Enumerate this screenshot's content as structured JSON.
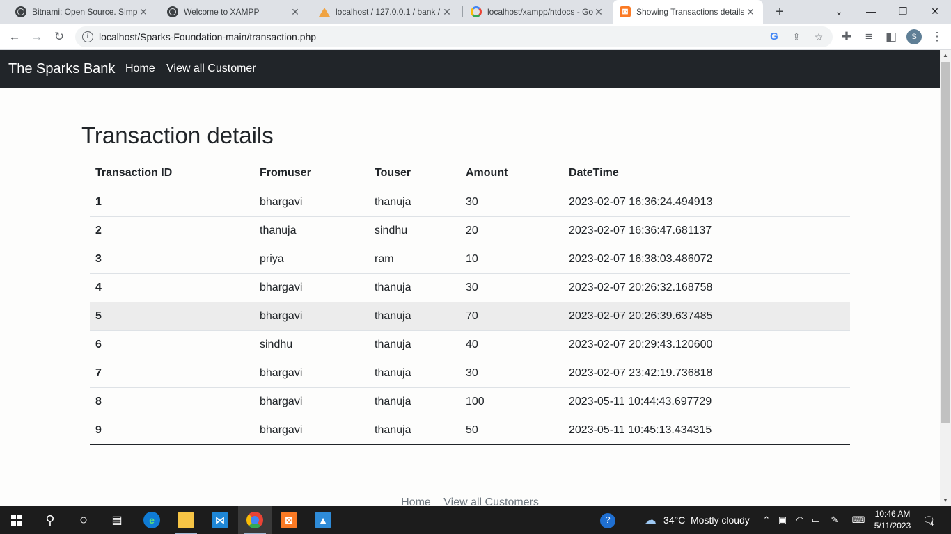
{
  "browser": {
    "tabs": [
      {
        "title": "Bitnami: Open Source. Simplified",
        "icon": "globe-icon",
        "active": false
      },
      {
        "title": "Welcome to XAMPP",
        "icon": "globe-icon",
        "active": false
      },
      {
        "title": "localhost / 127.0.0.1 / bank / ",
        "icon": "phpmyadmin-icon",
        "active": false
      },
      {
        "title": "localhost/xampp/htdocs - Google Search",
        "icon": "google-icon",
        "active": false
      },
      {
        "title": "Showing Transactions details",
        "icon": "xampp-icon",
        "active": true
      }
    ],
    "url": "localhost/Sparks-Foundation-main/transaction.php",
    "profile_initial": "S"
  },
  "navbar": {
    "brand": "The Sparks Bank",
    "links": [
      "Home",
      "View all Customer"
    ]
  },
  "page": {
    "title": "Transaction details",
    "table": {
      "headers": [
        "Transaction ID",
        "Fromuser",
        "Touser",
        "Amount",
        "DateTime"
      ],
      "rows": [
        [
          "1",
          "bhargavi",
          "thanuja",
          "30",
          "2023-02-07 16:36:24.494913"
        ],
        [
          "2",
          "thanuja",
          "sindhu",
          "20",
          "2023-02-07 16:36:47.681137"
        ],
        [
          "3",
          "priya",
          "ram",
          "10",
          "2023-02-07 16:38:03.486072"
        ],
        [
          "4",
          "bhargavi",
          "thanuja",
          "30",
          "2023-02-07 20:26:32.168758"
        ],
        [
          "5",
          "bhargavi",
          "thanuja",
          "70",
          "2023-02-07 20:26:39.637485"
        ],
        [
          "6",
          "sindhu",
          "thanuja",
          "40",
          "2023-02-07 20:29:43.120600"
        ],
        [
          "7",
          "bhargavi",
          "thanuja",
          "30",
          "2023-02-07 23:42:19.736818"
        ],
        [
          "8",
          "bhargavi",
          "thanuja",
          "100",
          "2023-05-11 10:44:43.697729"
        ],
        [
          "9",
          "bhargavi",
          "thanuja",
          "50",
          "2023-05-11 10:45:13.434315"
        ]
      ]
    },
    "footer_links": [
      "Home",
      "View all Customers"
    ]
  },
  "taskbar": {
    "weather_temp": "34°C",
    "weather_desc": "Mostly cloudy",
    "time": "10:46 AM",
    "date": "5/11/2023",
    "notification_count": "4"
  },
  "colors": {
    "navbar_bg": "#212529",
    "hover_row": "#ececec",
    "accent_xampp": "#fb7a24"
  }
}
